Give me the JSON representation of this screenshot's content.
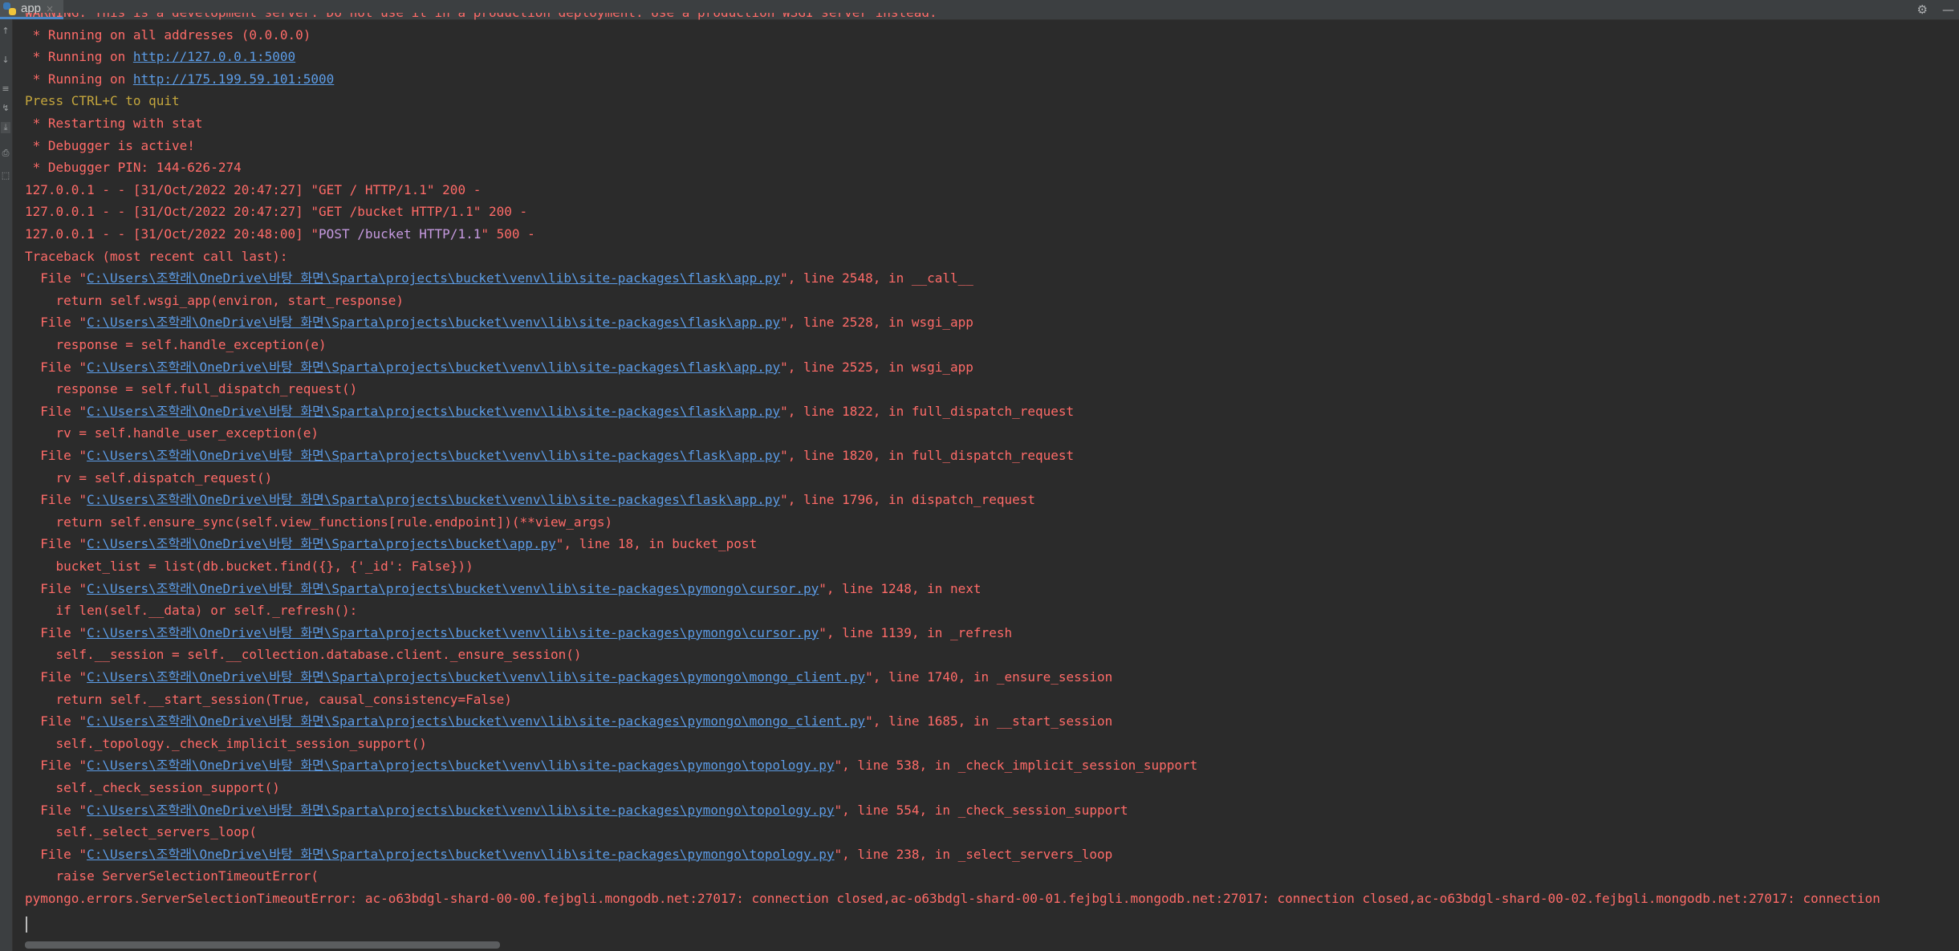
{
  "tab": {
    "label": "app",
    "close": "×"
  },
  "toolbar": {
    "settings_icon": "⚙",
    "minimize_icon": "—"
  },
  "left_icons": [
    "↑",
    "↓",
    "≡",
    "↯",
    "⤓",
    "⎙",
    "⬚"
  ],
  "lines": [
    [
      {
        "t": "WARNING: This is a development server. Do not use it in a production deployment. Use a production WSGI server instead."
      }
    ],
    [
      {
        "t": " * Running on all addresses (0.0.0.0)"
      }
    ],
    [
      {
        "t": " * Running on "
      },
      {
        "t": "http://127.0.0.1:5000",
        "c": "link"
      }
    ],
    [
      {
        "t": " * Running on "
      },
      {
        "t": "http://175.199.59.101:5000",
        "c": "link"
      }
    ],
    [
      {
        "t": "Press CTRL+C to quit",
        "c": "ln-yellow"
      }
    ],
    [
      {
        "t": " * Restarting with stat"
      }
    ],
    [
      {
        "t": " * Debugger is active!"
      }
    ],
    [
      {
        "t": " * Debugger PIN: 144-626-274"
      }
    ],
    [
      {
        "t": "127.0.0.1 - - [31/Oct/2022 20:47:27] \"GET / HTTP/1.1\" 200 -"
      }
    ],
    [
      {
        "t": "127.0.0.1 - - [31/Oct/2022 20:47:27] \"GET /bucket HTTP/1.1\" 200 -"
      }
    ],
    [
      {
        "t": "127.0.0.1 - - [31/Oct/2022 20:48:00] \""
      },
      {
        "t": "POST /bucket HTTP/1.1",
        "c": "purple"
      },
      {
        "t": "\" 500 -"
      }
    ],
    [
      {
        "t": "Traceback (most recent call last):"
      }
    ],
    [
      {
        "t": "  File \""
      },
      {
        "t": "C:\\Users\\조학래\\OneDrive\\바탕 화면\\Sparta\\projects\\bucket\\venv\\lib\\site-packages\\flask\\app.py",
        "c": "link"
      },
      {
        "t": "\", line 2548, in __call__"
      }
    ],
    [
      {
        "t": "    return self.wsgi_app(environ, start_response)"
      }
    ],
    [
      {
        "t": "  File \""
      },
      {
        "t": "C:\\Users\\조학래\\OneDrive\\바탕 화면\\Sparta\\projects\\bucket\\venv\\lib\\site-packages\\flask\\app.py",
        "c": "link"
      },
      {
        "t": "\", line 2528, in wsgi_app"
      }
    ],
    [
      {
        "t": "    response = self.handle_exception(e)"
      }
    ],
    [
      {
        "t": "  File \""
      },
      {
        "t": "C:\\Users\\조학래\\OneDrive\\바탕 화면\\Sparta\\projects\\bucket\\venv\\lib\\site-packages\\flask\\app.py",
        "c": "link"
      },
      {
        "t": "\", line 2525, in wsgi_app"
      }
    ],
    [
      {
        "t": "    response = self.full_dispatch_request()"
      }
    ],
    [
      {
        "t": "  File \""
      },
      {
        "t": "C:\\Users\\조학래\\OneDrive\\바탕 화면\\Sparta\\projects\\bucket\\venv\\lib\\site-packages\\flask\\app.py",
        "c": "link"
      },
      {
        "t": "\", line 1822, in full_dispatch_request"
      }
    ],
    [
      {
        "t": "    rv = self.handle_user_exception(e)"
      }
    ],
    [
      {
        "t": "  File \""
      },
      {
        "t": "C:\\Users\\조학래\\OneDrive\\바탕 화면\\Sparta\\projects\\bucket\\venv\\lib\\site-packages\\flask\\app.py",
        "c": "link"
      },
      {
        "t": "\", line 1820, in full_dispatch_request"
      }
    ],
    [
      {
        "t": "    rv = self.dispatch_request()"
      }
    ],
    [
      {
        "t": "  File \""
      },
      {
        "t": "C:\\Users\\조학래\\OneDrive\\바탕 화면\\Sparta\\projects\\bucket\\venv\\lib\\site-packages\\flask\\app.py",
        "c": "link"
      },
      {
        "t": "\", line 1796, in dispatch_request"
      }
    ],
    [
      {
        "t": "    return self.ensure_sync(self.view_functions[rule.endpoint])(**view_args)"
      }
    ],
    [
      {
        "t": "  File \""
      },
      {
        "t": "C:\\Users\\조학래\\OneDrive\\바탕 화면\\Sparta\\projects\\bucket\\app.py",
        "c": "link"
      },
      {
        "t": "\", line 18, in bucket_post"
      }
    ],
    [
      {
        "t": "    bucket_list = list(db.bucket.find({}, {'_id': False}))"
      }
    ],
    [
      {
        "t": "  File \""
      },
      {
        "t": "C:\\Users\\조학래\\OneDrive\\바탕 화면\\Sparta\\projects\\bucket\\venv\\lib\\site-packages\\pymongo\\cursor.py",
        "c": "link"
      },
      {
        "t": "\", line 1248, in next"
      }
    ],
    [
      {
        "t": "    if len(self.__data) or self._refresh():"
      }
    ],
    [
      {
        "t": "  File \""
      },
      {
        "t": "C:\\Users\\조학래\\OneDrive\\바탕 화면\\Sparta\\projects\\bucket\\venv\\lib\\site-packages\\pymongo\\cursor.py",
        "c": "link"
      },
      {
        "t": "\", line 1139, in _refresh"
      }
    ],
    [
      {
        "t": "    self.__session = self.__collection.database.client._ensure_session()"
      }
    ],
    [
      {
        "t": "  File \""
      },
      {
        "t": "C:\\Users\\조학래\\OneDrive\\바탕 화면\\Sparta\\projects\\bucket\\venv\\lib\\site-packages\\pymongo\\mongo_client.py",
        "c": "link"
      },
      {
        "t": "\", line 1740, in _ensure_session"
      }
    ],
    [
      {
        "t": "    return self.__start_session(True, causal_consistency=False)"
      }
    ],
    [
      {
        "t": "  File \""
      },
      {
        "t": "C:\\Users\\조학래\\OneDrive\\바탕 화면\\Sparta\\projects\\bucket\\venv\\lib\\site-packages\\pymongo\\mongo_client.py",
        "c": "link"
      },
      {
        "t": "\", line 1685, in __start_session"
      }
    ],
    [
      {
        "t": "    self._topology._check_implicit_session_support()"
      }
    ],
    [
      {
        "t": "  File \""
      },
      {
        "t": "C:\\Users\\조학래\\OneDrive\\바탕 화면\\Sparta\\projects\\bucket\\venv\\lib\\site-packages\\pymongo\\topology.py",
        "c": "link"
      },
      {
        "t": "\", line 538, in _check_implicit_session_support"
      }
    ],
    [
      {
        "t": "    self._check_session_support()"
      }
    ],
    [
      {
        "t": "  File \""
      },
      {
        "t": "C:\\Users\\조학래\\OneDrive\\바탕 화면\\Sparta\\projects\\bucket\\venv\\lib\\site-packages\\pymongo\\topology.py",
        "c": "link"
      },
      {
        "t": "\", line 554, in _check_session_support"
      }
    ],
    [
      {
        "t": "    self._select_servers_loop("
      }
    ],
    [
      {
        "t": "  File \""
      },
      {
        "t": "C:\\Users\\조학래\\OneDrive\\바탕 화면\\Sparta\\projects\\bucket\\venv\\lib\\site-packages\\pymongo\\topology.py",
        "c": "link"
      },
      {
        "t": "\", line 238, in _select_servers_loop"
      }
    ],
    [
      {
        "t": "    raise ServerSelectionTimeoutError("
      }
    ],
    [
      {
        "t": "pymongo.errors.ServerSelectionTimeoutError: ac-o63bdgl-shard-00-00.fejbgli.mongodb.net:27017: connection closed,ac-o63bdgl-shard-00-01.fejbgli.mongodb.net:27017: connection closed,ac-o63bdgl-shard-00-02.fejbgli.mongodb.net:27017: connection"
      }
    ]
  ]
}
